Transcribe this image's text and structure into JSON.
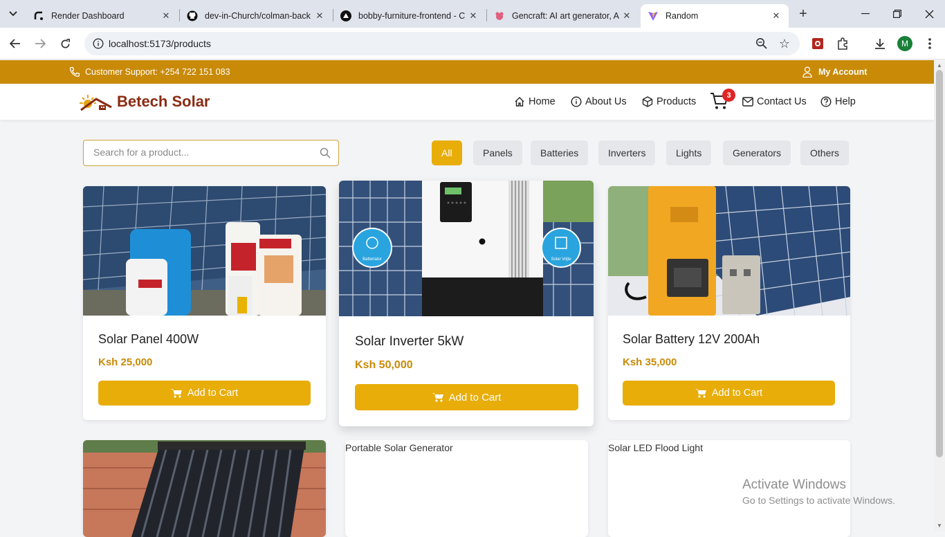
{
  "browser": {
    "tabs": [
      {
        "title": "Render Dashboard",
        "icon": "render-icon"
      },
      {
        "title": "dev-in-Church/colman-back",
        "icon": "github-icon"
      },
      {
        "title": "bobby-furniture-frontend - C",
        "icon": "vercel-icon"
      },
      {
        "title": "Gencraft: AI art generator, A",
        "icon": "gencraft-icon"
      },
      {
        "title": "Random",
        "icon": "vite-icon"
      }
    ],
    "url": "localhost:5173/products",
    "profile_initial": "M"
  },
  "site": {
    "support": "Customer Support: +254 722 151 083",
    "account": "My Account",
    "logo": "Betech Solar",
    "nav": [
      "Home",
      "About Us",
      "Products",
      "Contact Us",
      "Help"
    ],
    "cart_count": "3",
    "search_placeholder": "Search for a product...",
    "filters": [
      "All",
      "Panels",
      "Batteries",
      "Inverters",
      "Lights",
      "Generators",
      "Others"
    ],
    "active_filter": "All",
    "accent": "#e8ad08",
    "topbar_color": "#c98a08"
  },
  "products": [
    {
      "name": "Solar Panel 400W",
      "price": "Ksh 25,000",
      "button": "Add to Cart"
    },
    {
      "name": "Solar Inverter 5kW",
      "price": "Ksh 50,000",
      "button": "Add to Cart",
      "badge_left": "Batteriator",
      "badge_right": "Solar Vrijte"
    },
    {
      "name": "Solar Battery 12V 200Ah",
      "price": "Ksh 35,000",
      "button": "Add to Cart"
    },
    {
      "alt": ""
    },
    {
      "alt": "Portable Solar Generator"
    },
    {
      "alt": "Solar LED Flood Light"
    }
  ],
  "watermark": {
    "title": "Activate Windows",
    "subtitle": "Go to Settings to activate Windows."
  }
}
